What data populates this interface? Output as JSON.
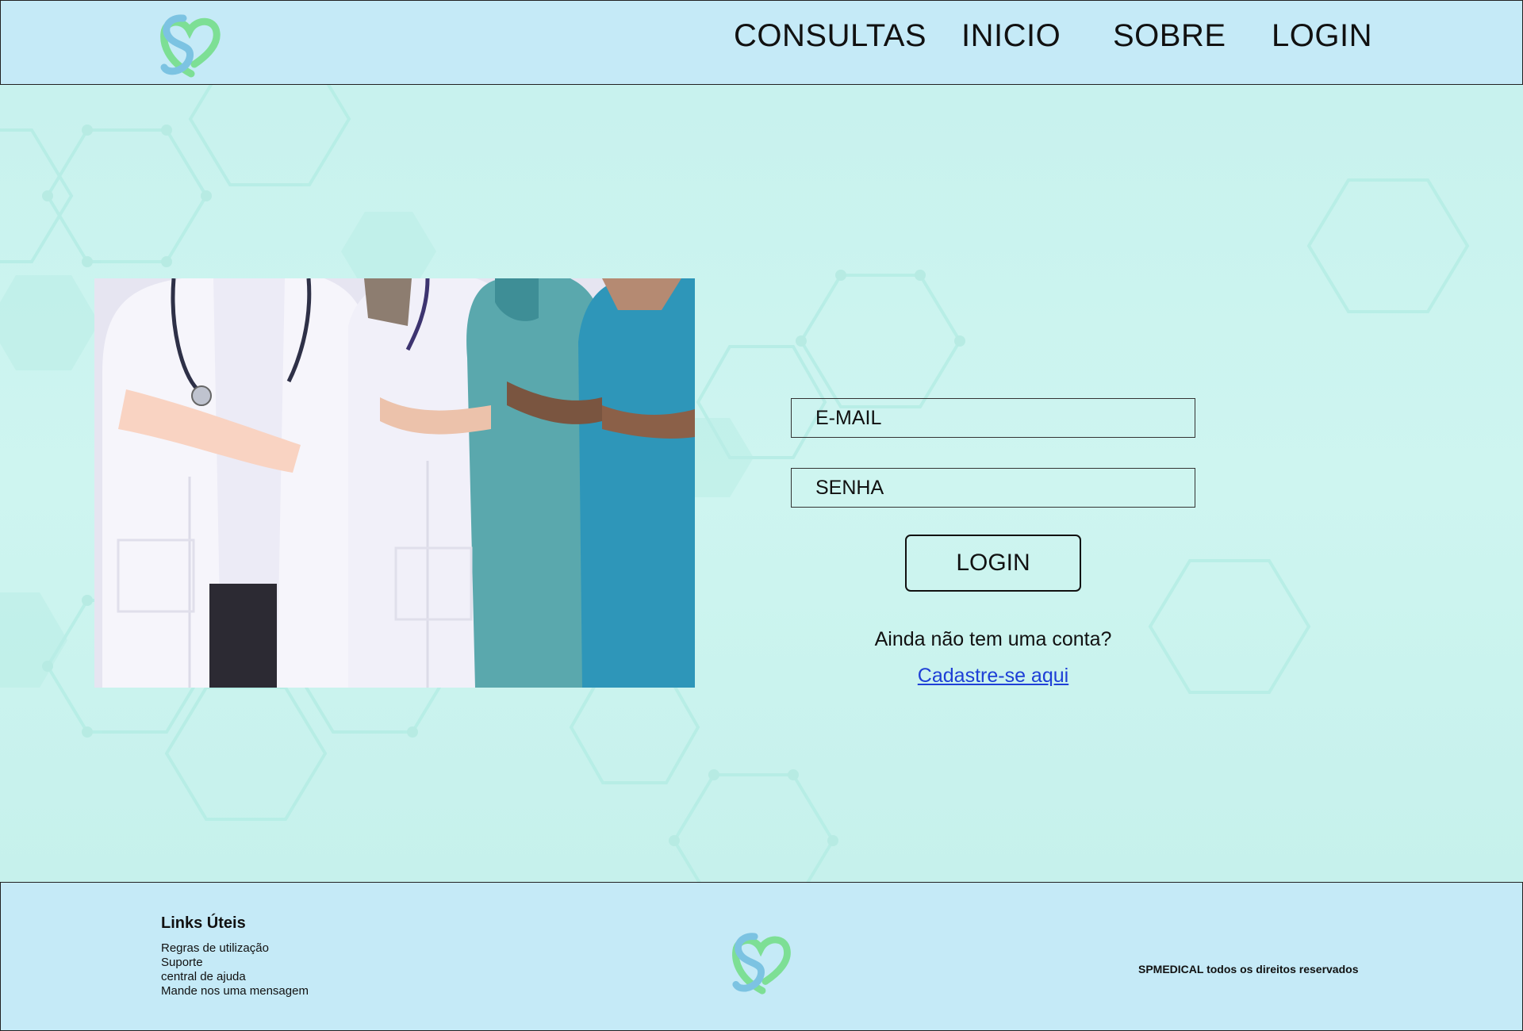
{
  "header": {
    "logo": "heart-logo-icon",
    "nav": [
      {
        "label": "CONSULTAS"
      },
      {
        "label": "INICIO"
      },
      {
        "label": "SOBRE"
      },
      {
        "label": "LOGIN"
      }
    ]
  },
  "main": {
    "image": "medical-team-photo",
    "form": {
      "email_placeholder": "E-MAIL",
      "password_placeholder": "SENHA",
      "login_label": "LOGIN",
      "no_account_text": "Ainda não tem uma conta?",
      "signup_link": "Cadastre-se aqui"
    }
  },
  "footer": {
    "title": "Links Úteis",
    "links": [
      "Regras de utilização",
      "Suporte",
      "central de ajuda",
      "Mande nos uma mensagem"
    ],
    "logo": "heart-logo-icon",
    "copyright": "SPMEDICAL todos os direitos reservados"
  },
  "colors": {
    "header_bg": "#c5eaf7",
    "main_bg": "#c8f2ee",
    "link": "#1e3fd6",
    "logo_blue": "#7cc3e2",
    "logo_green": "#7ddf95"
  }
}
